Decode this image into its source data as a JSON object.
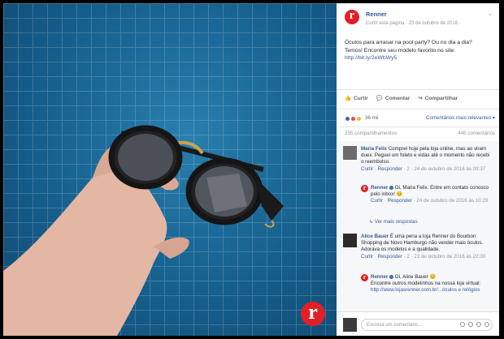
{
  "post": {
    "page_name": "Renner",
    "sub_line": "Curtir esta página · 23 de outubro de 2016 ·",
    "text_line1": "Óculos para arrasar na pool party? Ou no dia a dia?",
    "text_line2": "Temos! Encontre seu modelo favorito no site:",
    "link": "http://bit.ly/2eWbWy5",
    "brand_letter": "r"
  },
  "actions": {
    "like": "Curtir",
    "comment": "Comentar",
    "share": "Compartilhar"
  },
  "reactions": {
    "count": "36 mil",
    "sort": "Comentários mais relevantes ▾",
    "colors": [
      "#4267b2",
      "#f33e58",
      "#f7b125"
    ]
  },
  "counts": {
    "shares": "255 compartilhamentos",
    "comments": "445 comentários"
  },
  "comments": [
    {
      "name": "Maria Felix",
      "text": "Comprei hoje pela loja online, mas ao viram duex. Peguei um foleto e vidas até o momento não recebi o reembolso.",
      "meta_link1": "Curtir",
      "meta_link2": "Responder",
      "meta_rest": "· 2 · 24 de outubro de 2016 às 09:37",
      "reply": {
        "name": "Renner",
        "text": "Oi, Maria Felix. Entre em contato conosco pelo inbox!",
        "meta_link1": "Curtir",
        "meta_link2": "Responder",
        "meta_rest": "· 24 de outubro de 2016 às 10:29"
      },
      "more_replies": "Ver mais respostas"
    },
    {
      "name": "Alice Bauer",
      "text": "É uma pena a loja Renner do Bourbon Shopping de Novo Hamburgo não vender mais óculos. Adorava os modelos e a qualidade.",
      "meta_link1": "Curtir",
      "meta_link2": "Responder",
      "meta_rest": "· 2 · 23 de outubro de 2016 às 22:30",
      "reply": {
        "name": "Renner",
        "text": "Oi, Alice Bauer 😊",
        "text2": "Encontre outros modelinhos na nossa loja virtual:",
        "link": "http://www.lojasrenner.com.br/...óculos e relógios"
      }
    }
  ],
  "footer": {
    "placeholder": "Escreva um comentário..."
  }
}
